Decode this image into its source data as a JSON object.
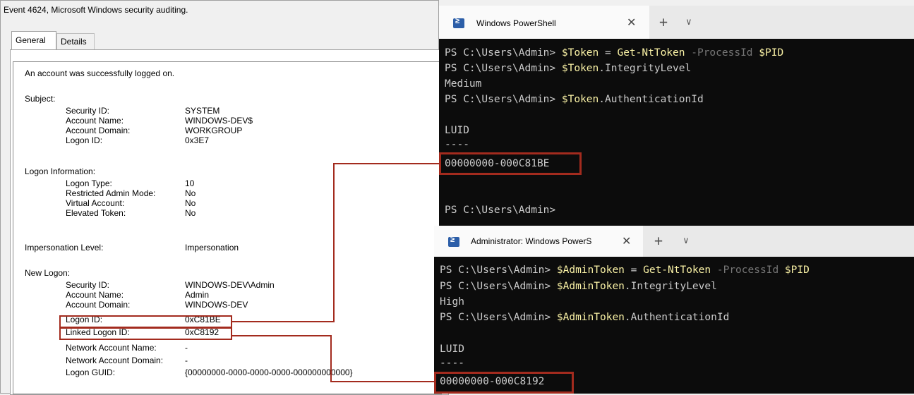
{
  "event_viewer": {
    "title": "Event 4624, Microsoft Windows security auditing.",
    "tabs": [
      "General",
      "Details"
    ],
    "summary": "An account was successfully logged on.",
    "subject_header": "Subject:",
    "subject": [
      {
        "label": "Security ID:",
        "value": "SYSTEM"
      },
      {
        "label": "Account Name:",
        "value": "WINDOWS-DEV$"
      },
      {
        "label": "Account Domain:",
        "value": "WORKGROUP"
      },
      {
        "label": "Logon ID:",
        "value": "0x3E7"
      }
    ],
    "logon_info_header": "Logon Information:",
    "logon_info": [
      {
        "label": "Logon Type:",
        "value": "10"
      },
      {
        "label": "Restricted Admin Mode:",
        "value": "No"
      },
      {
        "label": "Virtual Account:",
        "value": "No"
      },
      {
        "label": "Elevated Token:",
        "value": "No"
      }
    ],
    "impersonation_label": "Impersonation Level:",
    "impersonation_value": "Impersonation",
    "new_logon_header": "New Logon:",
    "new_logon": [
      {
        "label": "Security ID:",
        "value": "WINDOWS-DEV\\Admin"
      },
      {
        "label": "Account Name:",
        "value": "Admin"
      },
      {
        "label": "Account Domain:",
        "value": "WINDOWS-DEV"
      },
      {
        "label": "Logon ID:",
        "value": "0xC81BE"
      },
      {
        "label": "Linked Logon ID:",
        "value": "0xC8192"
      },
      {
        "label": "Network Account Name:",
        "value": "-"
      },
      {
        "label": "Network Account Domain:",
        "value": "-"
      },
      {
        "label": "Logon GUID:",
        "value": "{00000000-0000-0000-0000-000000000000}"
      }
    ]
  },
  "ps1": {
    "tab_title": "Windows PowerShell",
    "lines": {
      "l1_prompt": "PS C:\\Users\\Admin> ",
      "l1_var": "$Token",
      "l1_eq": " = ",
      "l1_cmd": "Get-NtToken",
      "l1_param": " -ProcessId ",
      "l1_pid": "$PID",
      "l2_prompt": "PS C:\\Users\\Admin> ",
      "l2_var": "$Token",
      "l2_prop": ".IntegrityLevel",
      "l3": "Medium",
      "l4_prompt": "PS C:\\Users\\Admin> ",
      "l4_var": "$Token",
      "l4_prop": ".AuthenticationId",
      "l5": "LUID",
      "l6": "----",
      "l7": "00000000-000C81BE",
      "l8": "PS C:\\Users\\Admin>"
    }
  },
  "ps2": {
    "tab_title": "Administrator: Windows PowerS",
    "lines": {
      "l1_prompt": "PS C:\\Users\\Admin> ",
      "l1_var": "$AdminToken",
      "l1_eq": " = ",
      "l1_cmd": "Get-NtToken",
      "l1_param": " -ProcessId ",
      "l1_pid": "$PID",
      "l2_prompt": "PS C:\\Users\\Admin> ",
      "l2_var": "$AdminToken",
      "l2_prop": ".IntegrityLevel",
      "l3": "High",
      "l4_prompt": "PS C:\\Users\\Admin> ",
      "l4_var": "$AdminToken",
      "l4_prop": ".AuthenticationId",
      "l5": "LUID",
      "l6": "----",
      "l7": "00000000-000C8192"
    }
  },
  "glyphs": {
    "close": "✕",
    "plus": "+",
    "chevron": "∨",
    "ps_icon": "≥"
  },
  "colors": {
    "highlight": "#a32b1e",
    "variable": "#f9f1a5",
    "parameter": "#767676",
    "terminal_bg": "#0c0c0c"
  }
}
